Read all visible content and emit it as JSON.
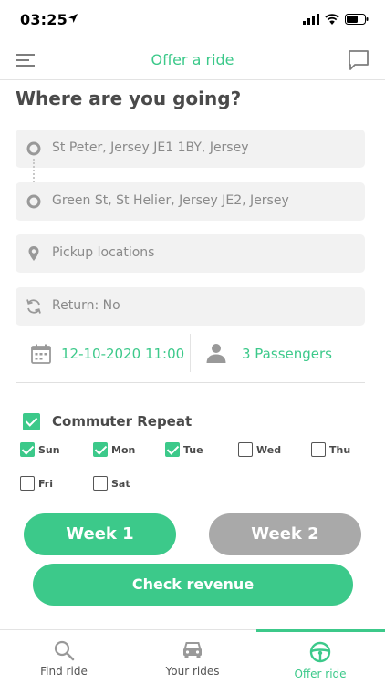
{
  "status": {
    "time": "03:25"
  },
  "nav": {
    "title": "Offer a ride"
  },
  "heading": "Where are you going?",
  "route": {
    "from": "St Peter, Jersey JE1 1BY, Jersey",
    "to": "Green St, St Helier, Jersey JE2, Jersey",
    "pickup": "Pickup locations",
    "return": "Return: No"
  },
  "schedule": {
    "datetime": "12-10-2020 11:00",
    "passengers": "3 Passengers"
  },
  "commuter": {
    "label": "Commuter Repeat",
    "checked": true,
    "days": [
      {
        "label": "Sun",
        "checked": true
      },
      {
        "label": "Mon",
        "checked": true
      },
      {
        "label": "Tue",
        "checked": true
      },
      {
        "label": "Wed",
        "checked": false
      },
      {
        "label": "Thu",
        "checked": false
      },
      {
        "label": "Fri",
        "checked": false
      },
      {
        "label": "Sat",
        "checked": false
      }
    ]
  },
  "buttons": {
    "week1": "Week 1",
    "week2": "Week 2",
    "revenue": "Check revenue"
  },
  "tabs": [
    {
      "label": "Find ride",
      "icon": "search-icon"
    },
    {
      "label": "Your rides",
      "icon": "car-icon"
    },
    {
      "label": "Offer ride",
      "icon": "steering-wheel-icon",
      "active": true
    }
  ],
  "colors": {
    "accent": "#3cc98a",
    "inactive_button": "#a9a9a9"
  }
}
